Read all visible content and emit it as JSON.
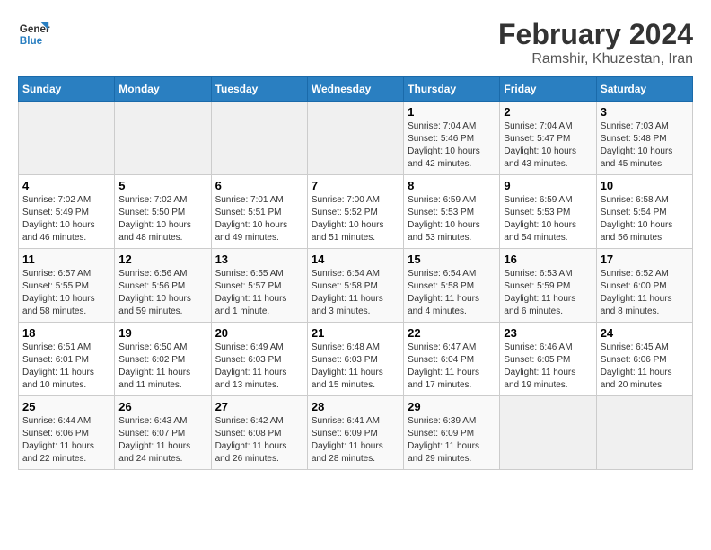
{
  "logo": {
    "line1": "General",
    "line2": "Blue"
  },
  "title": "February 2024",
  "subtitle": "Ramshir, Khuzestan, Iran",
  "headers": [
    "Sunday",
    "Monday",
    "Tuesday",
    "Wednesday",
    "Thursday",
    "Friday",
    "Saturday"
  ],
  "weeks": [
    [
      {
        "day": "",
        "info": ""
      },
      {
        "day": "",
        "info": ""
      },
      {
        "day": "",
        "info": ""
      },
      {
        "day": "",
        "info": ""
      },
      {
        "day": "1",
        "info": "Sunrise: 7:04 AM\nSunset: 5:46 PM\nDaylight: 10 hours and 42 minutes."
      },
      {
        "day": "2",
        "info": "Sunrise: 7:04 AM\nSunset: 5:47 PM\nDaylight: 10 hours and 43 minutes."
      },
      {
        "day": "3",
        "info": "Sunrise: 7:03 AM\nSunset: 5:48 PM\nDaylight: 10 hours and 45 minutes."
      }
    ],
    [
      {
        "day": "4",
        "info": "Sunrise: 7:02 AM\nSunset: 5:49 PM\nDaylight: 10 hours and 46 minutes."
      },
      {
        "day": "5",
        "info": "Sunrise: 7:02 AM\nSunset: 5:50 PM\nDaylight: 10 hours and 48 minutes."
      },
      {
        "day": "6",
        "info": "Sunrise: 7:01 AM\nSunset: 5:51 PM\nDaylight: 10 hours and 49 minutes."
      },
      {
        "day": "7",
        "info": "Sunrise: 7:00 AM\nSunset: 5:52 PM\nDaylight: 10 hours and 51 minutes."
      },
      {
        "day": "8",
        "info": "Sunrise: 6:59 AM\nSunset: 5:53 PM\nDaylight: 10 hours and 53 minutes."
      },
      {
        "day": "9",
        "info": "Sunrise: 6:59 AM\nSunset: 5:53 PM\nDaylight: 10 hours and 54 minutes."
      },
      {
        "day": "10",
        "info": "Sunrise: 6:58 AM\nSunset: 5:54 PM\nDaylight: 10 hours and 56 minutes."
      }
    ],
    [
      {
        "day": "11",
        "info": "Sunrise: 6:57 AM\nSunset: 5:55 PM\nDaylight: 10 hours and 58 minutes."
      },
      {
        "day": "12",
        "info": "Sunrise: 6:56 AM\nSunset: 5:56 PM\nDaylight: 10 hours and 59 minutes."
      },
      {
        "day": "13",
        "info": "Sunrise: 6:55 AM\nSunset: 5:57 PM\nDaylight: 11 hours and 1 minute."
      },
      {
        "day": "14",
        "info": "Sunrise: 6:54 AM\nSunset: 5:58 PM\nDaylight: 11 hours and 3 minutes."
      },
      {
        "day": "15",
        "info": "Sunrise: 6:54 AM\nSunset: 5:58 PM\nDaylight: 11 hours and 4 minutes."
      },
      {
        "day": "16",
        "info": "Sunrise: 6:53 AM\nSunset: 5:59 PM\nDaylight: 11 hours and 6 minutes."
      },
      {
        "day": "17",
        "info": "Sunrise: 6:52 AM\nSunset: 6:00 PM\nDaylight: 11 hours and 8 minutes."
      }
    ],
    [
      {
        "day": "18",
        "info": "Sunrise: 6:51 AM\nSunset: 6:01 PM\nDaylight: 11 hours and 10 minutes."
      },
      {
        "day": "19",
        "info": "Sunrise: 6:50 AM\nSunset: 6:02 PM\nDaylight: 11 hours and 11 minutes."
      },
      {
        "day": "20",
        "info": "Sunrise: 6:49 AM\nSunset: 6:03 PM\nDaylight: 11 hours and 13 minutes."
      },
      {
        "day": "21",
        "info": "Sunrise: 6:48 AM\nSunset: 6:03 PM\nDaylight: 11 hours and 15 minutes."
      },
      {
        "day": "22",
        "info": "Sunrise: 6:47 AM\nSunset: 6:04 PM\nDaylight: 11 hours and 17 minutes."
      },
      {
        "day": "23",
        "info": "Sunrise: 6:46 AM\nSunset: 6:05 PM\nDaylight: 11 hours and 19 minutes."
      },
      {
        "day": "24",
        "info": "Sunrise: 6:45 AM\nSunset: 6:06 PM\nDaylight: 11 hours and 20 minutes."
      }
    ],
    [
      {
        "day": "25",
        "info": "Sunrise: 6:44 AM\nSunset: 6:06 PM\nDaylight: 11 hours and 22 minutes."
      },
      {
        "day": "26",
        "info": "Sunrise: 6:43 AM\nSunset: 6:07 PM\nDaylight: 11 hours and 24 minutes."
      },
      {
        "day": "27",
        "info": "Sunrise: 6:42 AM\nSunset: 6:08 PM\nDaylight: 11 hours and 26 minutes."
      },
      {
        "day": "28",
        "info": "Sunrise: 6:41 AM\nSunset: 6:09 PM\nDaylight: 11 hours and 28 minutes."
      },
      {
        "day": "29",
        "info": "Sunrise: 6:39 AM\nSunset: 6:09 PM\nDaylight: 11 hours and 29 minutes."
      },
      {
        "day": "",
        "info": ""
      },
      {
        "day": "",
        "info": ""
      }
    ]
  ]
}
